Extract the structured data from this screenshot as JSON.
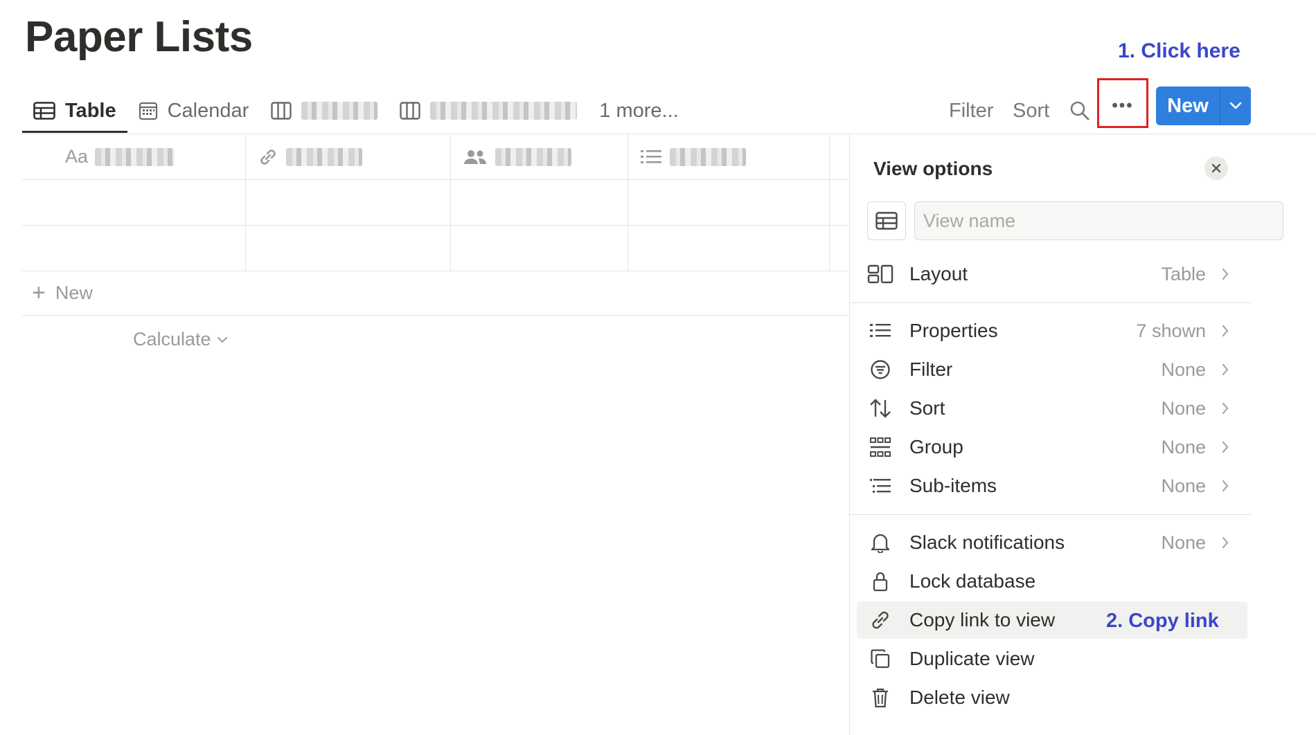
{
  "page": {
    "title": "Paper Lists"
  },
  "annotations": {
    "step1": "1. Click here",
    "step2": "2. Copy link"
  },
  "tabs": {
    "items": [
      {
        "label": "Table",
        "icon": "table-icon",
        "active": true
      },
      {
        "label": "Calendar",
        "icon": "calendar-icon"
      },
      {
        "label": "",
        "icon": "board-icon",
        "blurred": true
      },
      {
        "label": "",
        "icon": "board-icon",
        "blurred": true
      }
    ],
    "more": "1 more..."
  },
  "toolbar": {
    "filter": "Filter",
    "sort": "Sort",
    "more": "•••",
    "new": "New"
  },
  "table": {
    "header_prefix": "Aa",
    "new_row": "New",
    "calculate": "Calculate"
  },
  "panel": {
    "title": "View options",
    "name_placeholder": "View name",
    "items": {
      "layout": {
        "label": "Layout",
        "value": "Table"
      },
      "properties": {
        "label": "Properties",
        "value": "7 shown"
      },
      "filter": {
        "label": "Filter",
        "value": "None"
      },
      "sort": {
        "label": "Sort",
        "value": "None"
      },
      "group": {
        "label": "Group",
        "value": "None"
      },
      "subitems": {
        "label": "Sub-items",
        "value": "None"
      },
      "slack": {
        "label": "Slack notifications",
        "value": "None"
      },
      "lock": {
        "label": "Lock database"
      },
      "copy": {
        "label": "Copy link to view"
      },
      "duplicate": {
        "label": "Duplicate view"
      },
      "delete": {
        "label": "Delete view"
      }
    }
  },
  "colors": {
    "accent": "#2f7fde",
    "annotation": "#3b46c9",
    "highlight_box": "#e02020"
  }
}
